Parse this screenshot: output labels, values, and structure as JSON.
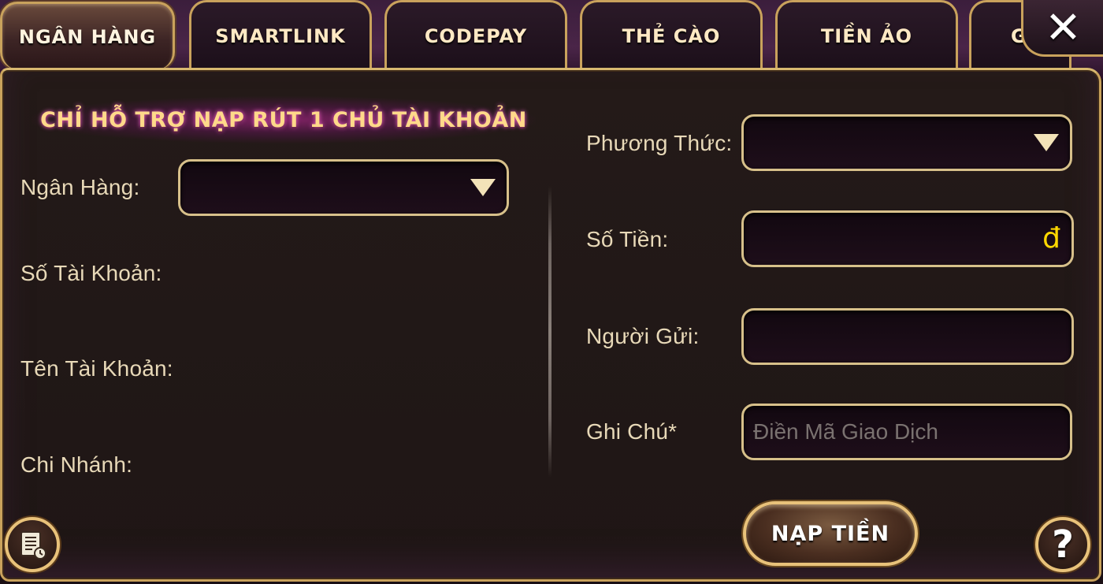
{
  "tabs": [
    {
      "label": "NGÂN HÀNG",
      "active": true
    },
    {
      "label": "SMARTLINK",
      "active": false
    },
    {
      "label": "CODEPAY",
      "active": false
    },
    {
      "label": "THẺ CÀO",
      "active": false
    },
    {
      "label": "TIỀN ẢO",
      "active": false
    },
    {
      "label": "G",
      "active": false
    }
  ],
  "close_icon": "close-icon",
  "banner": "CHỈ HỖ TRỢ NẠP RÚT 1 CHỦ TÀI KHOẢN",
  "left": {
    "bank_label": "Ngân Hàng:",
    "bank_value": "",
    "account_number_label": "Số Tài Khoản:",
    "account_name_label": "Tên Tài Khoản:",
    "branch_label": "Chi Nhánh:"
  },
  "right": {
    "method_label": "Phương Thức:",
    "method_value": "",
    "amount_label": "Số Tiền:",
    "amount_value": "",
    "currency_symbol": "đ",
    "sender_label": "Người Gửi:",
    "sender_value": "",
    "note_label": "Ghi Chú*",
    "note_value": "",
    "note_placeholder": "Điền Mã Giao Dịch"
  },
  "submit_label": "NẠP TIỀN",
  "history_icon": "history-icon",
  "help_icon": "help-icon",
  "help_glyph": "?",
  "colors": {
    "gold_border": "#c9a25c",
    "label_text": "#e8d9b8",
    "banner_text": "#ffd98a",
    "currency": "#ffd800",
    "panel_bg": "#211817"
  }
}
